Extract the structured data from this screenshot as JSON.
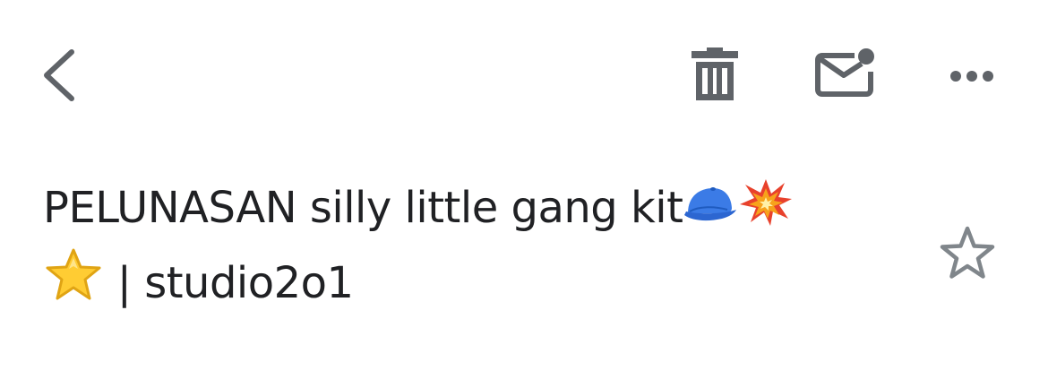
{
  "toolbar": {
    "back_icon": "chevron-left-icon",
    "delete_icon": "trash-icon",
    "mark_unread_icon": "mail-unread-icon",
    "more_icon": "more-horizontal-icon",
    "icon_color": "#5f6368"
  },
  "message": {
    "subject_line1": "PELUNASAN silly little gang kit",
    "subject_line2": " | studio2o1",
    "subject_emojis": [
      "cap-emoji",
      "collision-emoji",
      "star-emoji"
    ],
    "starred": false,
    "star_icon": "star-outline-icon",
    "star_color": "#80868b"
  }
}
